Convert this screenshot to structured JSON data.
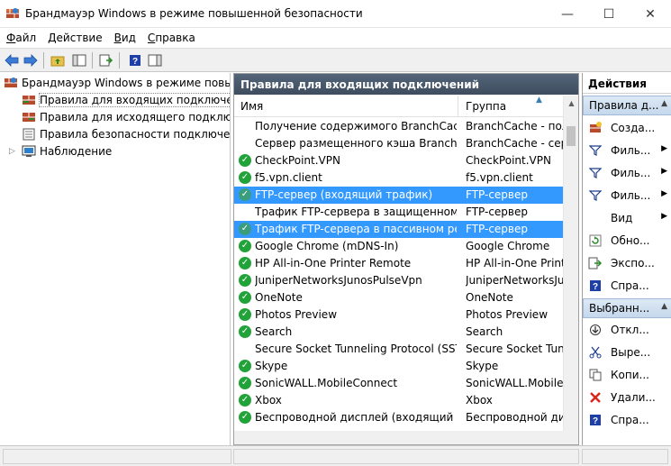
{
  "window": {
    "title": "Брандмауэр Windows в режиме повышенной безопасности",
    "minimize": "—",
    "maximize": "☐",
    "close": "✕"
  },
  "menu": {
    "file": "Файл",
    "action": "Действие",
    "view": "Вид",
    "help": "Справка"
  },
  "tree": {
    "root": "Брандмауэр Windows в режиме повышен",
    "items": [
      "Правила для входящих подключений",
      "Правила для исходящего подключе",
      "Правила безопасности подключения",
      "Наблюдение"
    ]
  },
  "center": {
    "header": "Правила для входящих подключений",
    "col_name": "Имя",
    "col_group": "Группа",
    "rows": [
      {
        "name": "Получение содержимого BranchCache ...",
        "group": "BranchCache - полу",
        "enabled": false
      },
      {
        "name": "Сервер размещенного кэша BranchCa...",
        "group": "BranchCache - серв",
        "enabled": false
      },
      {
        "name": "CheckPoint.VPN",
        "group": "CheckPoint.VPN",
        "enabled": true
      },
      {
        "name": "f5.vpn.client",
        "group": "f5.vpn.client",
        "enabled": true
      },
      {
        "name": "FTP-сервер (входящий трафик)",
        "group": "FTP-сервер",
        "enabled": true
      },
      {
        "name": "Трафик FTP-сервера в защищенном р...",
        "group": "FTP-сервер",
        "enabled": false
      },
      {
        "name": "Трафик FTP-сервера в пассивном реж...",
        "group": "FTP-сервер",
        "enabled": true
      },
      {
        "name": "Google Chrome (mDNS-In)",
        "group": "Google Chrome",
        "enabled": true
      },
      {
        "name": "HP All-in-One Printer Remote",
        "group": "HP All-in-One Printe",
        "enabled": true
      },
      {
        "name": "JuniperNetworksJunosPulseVpn",
        "group": "JuniperNetworksJun",
        "enabled": true
      },
      {
        "name": "OneNote",
        "group": "OneNote",
        "enabled": true
      },
      {
        "name": "Photos Preview",
        "group": "Photos Preview",
        "enabled": true
      },
      {
        "name": "Search",
        "group": "Search",
        "enabled": true
      },
      {
        "name": "Secure Socket Tunneling Protocol (SSTP-...",
        "group": "Secure Socket Tunne",
        "enabled": false
      },
      {
        "name": "Skype",
        "group": "Skype",
        "enabled": true
      },
      {
        "name": "SonicWALL.MobileConnect",
        "group": "SonicWALL.MobileCo",
        "enabled": true
      },
      {
        "name": "Xbox",
        "group": "Xbox",
        "enabled": true
      },
      {
        "name": "Беспроводной дисплей (входящий тра...",
        "group": "Беспроводной дисп",
        "enabled": true
      }
    ]
  },
  "actions": {
    "header": "Действия",
    "section1": "Правила д...",
    "section1_items": [
      {
        "label": "Созда...",
        "icon": "new-rule-icon",
        "arrow": false
      },
      {
        "label": "Филь...",
        "icon": "filter-icon",
        "arrow": true
      },
      {
        "label": "Филь...",
        "icon": "filter-icon",
        "arrow": true
      },
      {
        "label": "Филь...",
        "icon": "filter-icon",
        "arrow": true
      },
      {
        "label": "Вид",
        "icon": "none",
        "arrow": true
      },
      {
        "label": "Обно...",
        "icon": "refresh-icon",
        "arrow": false
      },
      {
        "label": "Экспо...",
        "icon": "export-icon",
        "arrow": false
      },
      {
        "label": "Спра...",
        "icon": "help-icon",
        "arrow": false
      }
    ],
    "section2": "Выбранн...",
    "section2_items": [
      {
        "label": "Откл...",
        "icon": "disable-icon",
        "arrow": false
      },
      {
        "label": "Выре...",
        "icon": "cut-icon",
        "arrow": false
      },
      {
        "label": "Копи...",
        "icon": "copy-icon",
        "arrow": false
      },
      {
        "label": "Удали...",
        "icon": "delete-icon",
        "arrow": false
      },
      {
        "label": "Спра...",
        "icon": "help-icon",
        "arrow": false
      }
    ]
  },
  "colors": {
    "selection": "#3399ff",
    "header_dark": "#4a5a6a",
    "enabled_green": "#22a33a"
  }
}
